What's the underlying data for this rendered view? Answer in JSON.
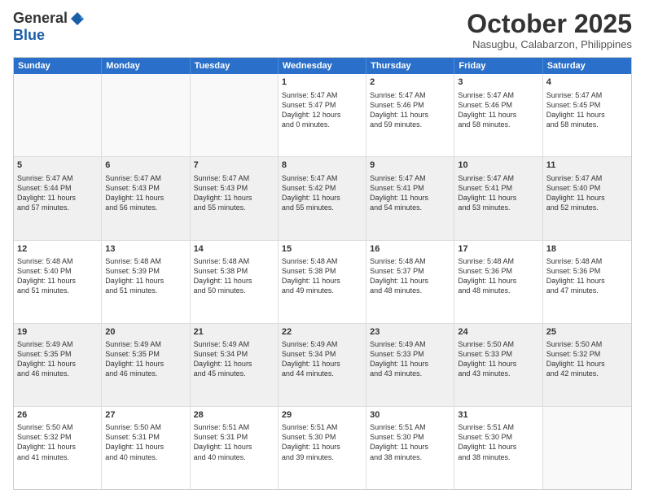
{
  "header": {
    "logo_general": "General",
    "logo_blue": "Blue",
    "month_title": "October 2025",
    "location": "Nasugbu, Calabarzon, Philippines"
  },
  "calendar": {
    "days_of_week": [
      "Sunday",
      "Monday",
      "Tuesday",
      "Wednesday",
      "Thursday",
      "Friday",
      "Saturday"
    ],
    "rows": [
      [
        {
          "day": "",
          "empty": true
        },
        {
          "day": "",
          "empty": true
        },
        {
          "day": "",
          "empty": true
        },
        {
          "day": "1",
          "line1": "Sunrise: 5:47 AM",
          "line2": "Sunset: 5:47 PM",
          "line3": "Daylight: 12 hours",
          "line4": "and 0 minutes."
        },
        {
          "day": "2",
          "line1": "Sunrise: 5:47 AM",
          "line2": "Sunset: 5:46 PM",
          "line3": "Daylight: 11 hours",
          "line4": "and 59 minutes."
        },
        {
          "day": "3",
          "line1": "Sunrise: 5:47 AM",
          "line2": "Sunset: 5:46 PM",
          "line3": "Daylight: 11 hours",
          "line4": "and 58 minutes."
        },
        {
          "day": "4",
          "line1": "Sunrise: 5:47 AM",
          "line2": "Sunset: 5:45 PM",
          "line3": "Daylight: 11 hours",
          "line4": "and 58 minutes."
        }
      ],
      [
        {
          "day": "5",
          "line1": "Sunrise: 5:47 AM",
          "line2": "Sunset: 5:44 PM",
          "line3": "Daylight: 11 hours",
          "line4": "and 57 minutes."
        },
        {
          "day": "6",
          "line1": "Sunrise: 5:47 AM",
          "line2": "Sunset: 5:43 PM",
          "line3": "Daylight: 11 hours",
          "line4": "and 56 minutes."
        },
        {
          "day": "7",
          "line1": "Sunrise: 5:47 AM",
          "line2": "Sunset: 5:43 PM",
          "line3": "Daylight: 11 hours",
          "line4": "and 55 minutes."
        },
        {
          "day": "8",
          "line1": "Sunrise: 5:47 AM",
          "line2": "Sunset: 5:42 PM",
          "line3": "Daylight: 11 hours",
          "line4": "and 55 minutes."
        },
        {
          "day": "9",
          "line1": "Sunrise: 5:47 AM",
          "line2": "Sunset: 5:41 PM",
          "line3": "Daylight: 11 hours",
          "line4": "and 54 minutes."
        },
        {
          "day": "10",
          "line1": "Sunrise: 5:47 AM",
          "line2": "Sunset: 5:41 PM",
          "line3": "Daylight: 11 hours",
          "line4": "and 53 minutes."
        },
        {
          "day": "11",
          "line1": "Sunrise: 5:47 AM",
          "line2": "Sunset: 5:40 PM",
          "line3": "Daylight: 11 hours",
          "line4": "and 52 minutes."
        }
      ],
      [
        {
          "day": "12",
          "line1": "Sunrise: 5:48 AM",
          "line2": "Sunset: 5:40 PM",
          "line3": "Daylight: 11 hours",
          "line4": "and 51 minutes."
        },
        {
          "day": "13",
          "line1": "Sunrise: 5:48 AM",
          "line2": "Sunset: 5:39 PM",
          "line3": "Daylight: 11 hours",
          "line4": "and 51 minutes."
        },
        {
          "day": "14",
          "line1": "Sunrise: 5:48 AM",
          "line2": "Sunset: 5:38 PM",
          "line3": "Daylight: 11 hours",
          "line4": "and 50 minutes."
        },
        {
          "day": "15",
          "line1": "Sunrise: 5:48 AM",
          "line2": "Sunset: 5:38 PM",
          "line3": "Daylight: 11 hours",
          "line4": "and 49 minutes."
        },
        {
          "day": "16",
          "line1": "Sunrise: 5:48 AM",
          "line2": "Sunset: 5:37 PM",
          "line3": "Daylight: 11 hours",
          "line4": "and 48 minutes."
        },
        {
          "day": "17",
          "line1": "Sunrise: 5:48 AM",
          "line2": "Sunset: 5:36 PM",
          "line3": "Daylight: 11 hours",
          "line4": "and 48 minutes."
        },
        {
          "day": "18",
          "line1": "Sunrise: 5:48 AM",
          "line2": "Sunset: 5:36 PM",
          "line3": "Daylight: 11 hours",
          "line4": "and 47 minutes."
        }
      ],
      [
        {
          "day": "19",
          "line1": "Sunrise: 5:49 AM",
          "line2": "Sunset: 5:35 PM",
          "line3": "Daylight: 11 hours",
          "line4": "and 46 minutes."
        },
        {
          "day": "20",
          "line1": "Sunrise: 5:49 AM",
          "line2": "Sunset: 5:35 PM",
          "line3": "Daylight: 11 hours",
          "line4": "and 46 minutes."
        },
        {
          "day": "21",
          "line1": "Sunrise: 5:49 AM",
          "line2": "Sunset: 5:34 PM",
          "line3": "Daylight: 11 hours",
          "line4": "and 45 minutes."
        },
        {
          "day": "22",
          "line1": "Sunrise: 5:49 AM",
          "line2": "Sunset: 5:34 PM",
          "line3": "Daylight: 11 hours",
          "line4": "and 44 minutes."
        },
        {
          "day": "23",
          "line1": "Sunrise: 5:49 AM",
          "line2": "Sunset: 5:33 PM",
          "line3": "Daylight: 11 hours",
          "line4": "and 43 minutes."
        },
        {
          "day": "24",
          "line1": "Sunrise: 5:50 AM",
          "line2": "Sunset: 5:33 PM",
          "line3": "Daylight: 11 hours",
          "line4": "and 43 minutes."
        },
        {
          "day": "25",
          "line1": "Sunrise: 5:50 AM",
          "line2": "Sunset: 5:32 PM",
          "line3": "Daylight: 11 hours",
          "line4": "and 42 minutes."
        }
      ],
      [
        {
          "day": "26",
          "line1": "Sunrise: 5:50 AM",
          "line2": "Sunset: 5:32 PM",
          "line3": "Daylight: 11 hours",
          "line4": "and 41 minutes."
        },
        {
          "day": "27",
          "line1": "Sunrise: 5:50 AM",
          "line2": "Sunset: 5:31 PM",
          "line3": "Daylight: 11 hours",
          "line4": "and 40 minutes."
        },
        {
          "day": "28",
          "line1": "Sunrise: 5:51 AM",
          "line2": "Sunset: 5:31 PM",
          "line3": "Daylight: 11 hours",
          "line4": "and 40 minutes."
        },
        {
          "day": "29",
          "line1": "Sunrise: 5:51 AM",
          "line2": "Sunset: 5:30 PM",
          "line3": "Daylight: 11 hours",
          "line4": "and 39 minutes."
        },
        {
          "day": "30",
          "line1": "Sunrise: 5:51 AM",
          "line2": "Sunset: 5:30 PM",
          "line3": "Daylight: 11 hours",
          "line4": "and 38 minutes."
        },
        {
          "day": "31",
          "line1": "Sunrise: 5:51 AM",
          "line2": "Sunset: 5:30 PM",
          "line3": "Daylight: 11 hours",
          "line4": "and 38 minutes."
        },
        {
          "day": "",
          "empty": true
        }
      ]
    ]
  }
}
